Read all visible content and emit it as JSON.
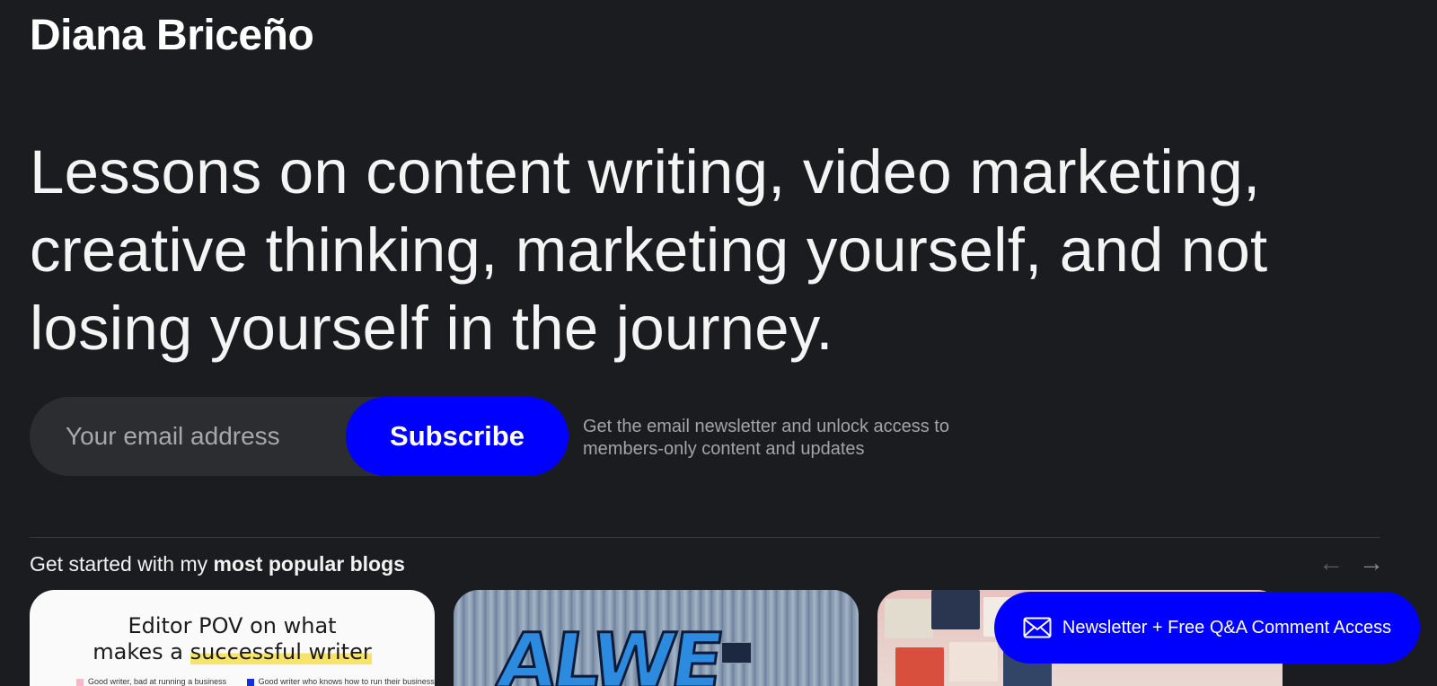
{
  "site": {
    "title": "Diana Briceño"
  },
  "hero": {
    "text": "Lessons on content writing, video marketing, creative thinking, marketing yourself, and not losing yourself in the journey."
  },
  "signup": {
    "email_placeholder": "Your email address",
    "subscribe_label": "Subscribe",
    "note": "Get the email newsletter and unlock access to members-only content and updates"
  },
  "popular": {
    "heading_prefix": "Get started with my ",
    "heading_bold": "most popular blogs",
    "prev_arrow": "←",
    "next_arrow": "→",
    "cards": [
      {
        "title_line1": "Editor POV on what",
        "title_line2_pre": "makes a ",
        "title_line2_highlight": "successful writer",
        "legend_left": "Good writer, bad at running a business",
        "legend_right": "Good writer who knows how to run their business"
      },
      {
        "image": "graffiti-wall"
      },
      {
        "image": "video-content-collage"
      }
    ]
  },
  "newsletter_cta": {
    "label": "Newsletter + Free Q&A Comment Access",
    "icon": "envelope-icon"
  },
  "colors": {
    "background": "#1b1c1f",
    "accent": "#0000ff",
    "input_bg": "#2c2d31",
    "muted_text": "#a3a4a9"
  }
}
